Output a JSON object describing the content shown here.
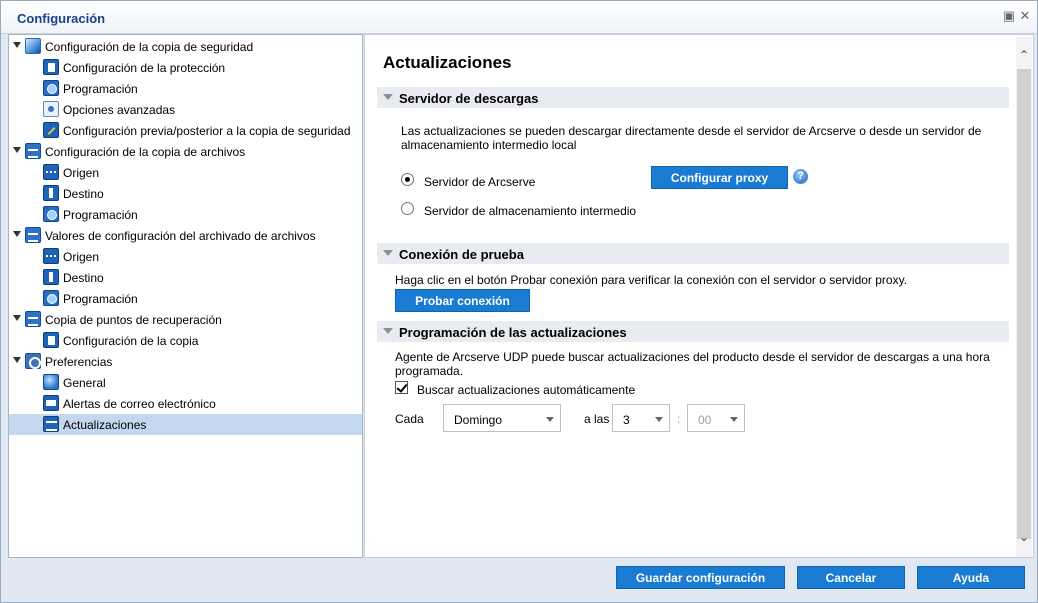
{
  "window": {
    "title": "Configuración",
    "restore_icon": "restore-icon",
    "close_icon": "close-icon"
  },
  "tree": {
    "items": [
      {
        "label": "Configuración de la copia de seguridad",
        "level": 0,
        "icon": "backup-icon"
      },
      {
        "label": "Configuración de la protección",
        "level": 1,
        "icon": "protection-icon"
      },
      {
        "label": "Programación",
        "level": 1,
        "icon": "schedule-icon"
      },
      {
        "label": "Opciones avanzadas",
        "level": 1,
        "icon": "advanced-options-icon"
      },
      {
        "label": "Configuración previa/posterior a la copia de seguridad",
        "level": 1,
        "icon": "pre-post-icon"
      },
      {
        "label": "Configuración de la copia de archivos",
        "level": 0,
        "icon": "file-copy-icon"
      },
      {
        "label": "Origen",
        "level": 1,
        "icon": "source-icon"
      },
      {
        "label": "Destino",
        "level": 1,
        "icon": "destination-icon"
      },
      {
        "label": "Programación",
        "level": 1,
        "icon": "schedule-icon"
      },
      {
        "label": "Valores de configuración del archivado de archivos",
        "level": 0,
        "icon": "file-archive-icon"
      },
      {
        "label": "Origen",
        "level": 1,
        "icon": "source-icon"
      },
      {
        "label": "Destino",
        "level": 1,
        "icon": "destination-icon"
      },
      {
        "label": "Programación",
        "level": 1,
        "icon": "schedule-icon"
      },
      {
        "label": "Copia de puntos de recuperación",
        "level": 0,
        "icon": "recovery-copy-icon"
      },
      {
        "label": "Configuración de la copia",
        "level": 1,
        "icon": "copy-settings-icon"
      },
      {
        "label": "Preferencias",
        "level": 0,
        "icon": "preferences-icon"
      },
      {
        "label": "General",
        "level": 1,
        "icon": "general-icon"
      },
      {
        "label": "Alertas de correo electrónico",
        "level": 1,
        "icon": "email-alerts-icon"
      },
      {
        "label": "Actualizaciones",
        "level": 1,
        "icon": "updates-icon",
        "selected": true
      }
    ]
  },
  "panel": {
    "title": "Actualizaciones",
    "download_server": {
      "heading": "Servidor de descargas",
      "description": "Las actualizaciones se pueden descargar directamente desde el servidor de Arcserve o desde un servidor de almacenamiento intermedio local",
      "option_arcserve": "Servidor de Arcserve",
      "option_staging": "Servidor de almacenamiento intermedio",
      "selected": "arcserve",
      "proxy_button": "Configurar proxy",
      "help_icon": "help-icon"
    },
    "test_connection": {
      "heading": "Conexión de prueba",
      "description": "Haga clic en el botón Probar conexión para verificar la conexión con el servidor o servidor proxy.",
      "button": "Probar conexión"
    },
    "update_schedule": {
      "heading": "Programación de las actualizaciones",
      "description": "Agente de Arcserve UDP puede buscar actualizaciones del producto desde el servidor de descargas a una hora programada.",
      "auto_check_label": "Buscar actualizaciones automáticamente",
      "auto_check": true,
      "every_label": "Cada",
      "day_value": "Domingo",
      "at_label": "a las",
      "hour_value": "3",
      "separator": ":",
      "minute_value": "00"
    }
  },
  "footer": {
    "save_button": "Guardar configuración",
    "cancel_button": "Cancelar",
    "help_button": "Ayuda"
  }
}
